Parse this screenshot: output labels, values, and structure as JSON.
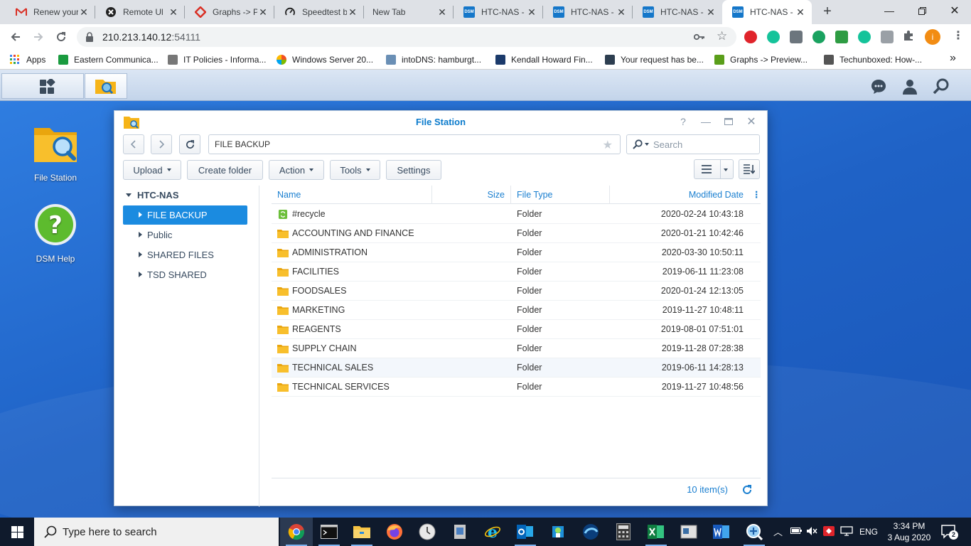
{
  "browser": {
    "tabs": [
      {
        "title": "Renew your",
        "icon": "gmail-icon",
        "color": "#d93025",
        "active": false
      },
      {
        "title": "Remote Ul",
        "icon": "remote-icon",
        "color": "#222222",
        "active": false
      },
      {
        "title": "Graphs -> P",
        "icon": "graphs-icon",
        "color": "#d93025",
        "active": false
      },
      {
        "title": "Speedtest b",
        "icon": "speedtest-icon",
        "color": "#222222",
        "active": false
      },
      {
        "title": "New Tab",
        "icon": "",
        "color": "",
        "active": false
      },
      {
        "title": "HTC-NAS -",
        "icon": "dsm-icon",
        "color": "#1577c9",
        "active": false
      },
      {
        "title": "HTC-NAS -",
        "icon": "dsm-icon",
        "color": "#1577c9",
        "active": false
      },
      {
        "title": "HTC-NAS -",
        "icon": "dsm-icon",
        "color": "#1577c9",
        "active": false
      },
      {
        "title": "HTC-NAS -",
        "icon": "dsm-icon",
        "color": "#1577c9",
        "active": true
      }
    ],
    "dsm_favicon_text": "DSM",
    "url_host": "210.213.140.12",
    "url_port": ":54111",
    "profile_initial": "i",
    "bookmarks": [
      {
        "label": "Apps",
        "color": "#4285f4"
      },
      {
        "label": "Eastern Communica...",
        "color": "#1a9b3f"
      },
      {
        "label": "IT Policies - Informa...",
        "color": "#777777"
      },
      {
        "label": "Windows Server 20...",
        "color": "#f25022"
      },
      {
        "label": "intoDNS: hamburgt...",
        "color": "#6a8fb5"
      },
      {
        "label": "Kendall Howard Fin...",
        "color": "#1b3a6b"
      },
      {
        "label": "Your request has be...",
        "color": "#2d3e50"
      },
      {
        "label": "Graphs -> Preview...",
        "color": "#5a9e1a"
      },
      {
        "label": "Techunboxed: How-...",
        "color": "#555555"
      }
    ]
  },
  "desktop": {
    "icons": [
      {
        "label": "File Station"
      },
      {
        "label": "DSM Help"
      }
    ]
  },
  "filestation": {
    "title": "File Station",
    "path": "FILE BACKUP",
    "search_placeholder": "Search",
    "toolbar": {
      "upload": "Upload",
      "create_folder": "Create folder",
      "action": "Action",
      "tools": "Tools",
      "settings": "Settings"
    },
    "tree": {
      "root": "HTC-NAS",
      "items": [
        {
          "label": "FILE BACKUP",
          "selected": true
        },
        {
          "label": "Public",
          "selected": false
        },
        {
          "label": "SHARED FILES",
          "selected": false
        },
        {
          "label": "TSD SHARED",
          "selected": false
        }
      ]
    },
    "columns": {
      "name": "Name",
      "size": "Size",
      "type": "File Type",
      "modified": "Modified Date"
    },
    "rows": [
      {
        "name": "#recycle",
        "size": "",
        "type": "Folder",
        "modified": "2020-02-24 10:43:18",
        "recycle": true
      },
      {
        "name": "ACCOUNTING AND FINANCE",
        "size": "",
        "type": "Folder",
        "modified": "2020-01-21 10:42:46"
      },
      {
        "name": "ADMINISTRATION",
        "size": "",
        "type": "Folder",
        "modified": "2020-03-30 10:50:11"
      },
      {
        "name": "FACILITIES",
        "size": "",
        "type": "Folder",
        "modified": "2019-06-11 11:23:08"
      },
      {
        "name": "FOODSALES",
        "size": "",
        "type": "Folder",
        "modified": "2020-01-24 12:13:05"
      },
      {
        "name": "MARKETING",
        "size": "",
        "type": "Folder",
        "modified": "2019-11-27 10:48:11"
      },
      {
        "name": "REAGENTS",
        "size": "",
        "type": "Folder",
        "modified": "2019-08-01 07:51:01"
      },
      {
        "name": "SUPPLY CHAIN",
        "size": "",
        "type": "Folder",
        "modified": "2019-11-28 07:28:38"
      },
      {
        "name": "TECHNICAL SALES",
        "size": "",
        "type": "Folder",
        "modified": "2019-06-11 14:28:13",
        "highlight": true
      },
      {
        "name": "TECHNICAL SERVICES",
        "size": "",
        "type": "Folder",
        "modified": "2019-11-27 10:48:56"
      }
    ],
    "item_count": "10 item(s)"
  },
  "taskbar": {
    "search_placeholder": "Type here to search",
    "language": "ENG",
    "time": "3:34 PM",
    "date": "3 Aug 2020",
    "notifications": "2"
  },
  "colors": {
    "accent": "#1b8be0",
    "dsm_title": "#0b7bcc",
    "folder": "#f6b418",
    "taskbar": "#0f1a2c"
  }
}
